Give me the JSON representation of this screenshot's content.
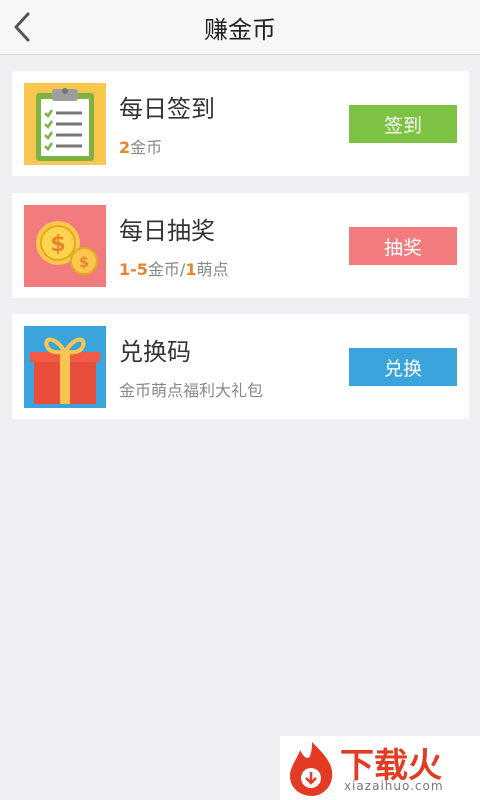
{
  "header": {
    "title": "赚金币"
  },
  "cards": [
    {
      "title": "每日签到",
      "sub_highlight_1": "2",
      "sub_text_1": "金币",
      "sub_separator": "",
      "sub_highlight_2": "",
      "sub_text_2": "",
      "button_label": "签到",
      "icon": "clipboard-checklist-icon"
    },
    {
      "title": "每日抽奖",
      "sub_highlight_1": "1-5",
      "sub_text_1": "金币/",
      "sub_highlight_2": "1",
      "sub_text_2": "萌点",
      "button_label": "抽奖",
      "icon": "coins-icon"
    },
    {
      "title": "兑换码",
      "sub_plain": "金币萌点福利大礼包",
      "button_label": "兑换",
      "icon": "gift-box-icon"
    }
  ],
  "colors": {
    "sign_button": "#7dc242",
    "lottery_button": "#f27b7e",
    "redeem_button": "#3ba4dc",
    "highlight": "#e8822b"
  },
  "watermark": {
    "text": "下载火",
    "url": "xiazaihuo.com"
  }
}
